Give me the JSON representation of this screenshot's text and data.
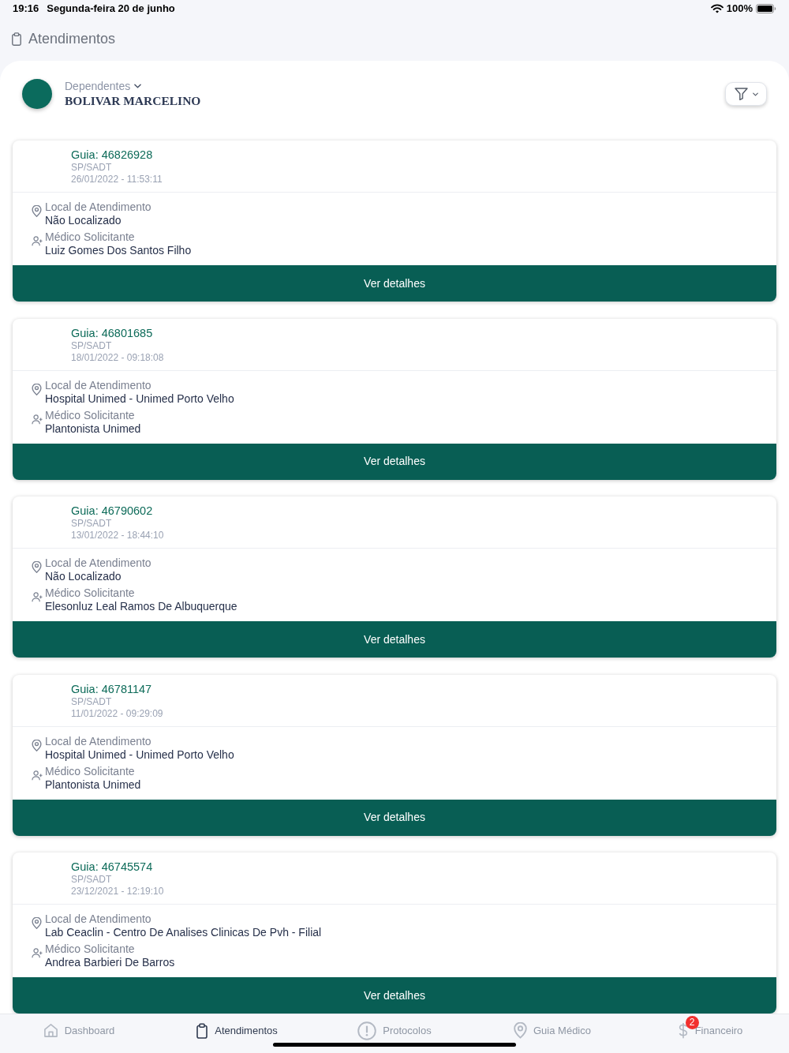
{
  "status_bar": {
    "time": "19:16",
    "date": "Segunda-feira 20 de junho",
    "battery": "100%"
  },
  "header": {
    "title": "Atendimentos"
  },
  "profile": {
    "dropdown_label": "Dependentes",
    "name": "BOLIVAR MARCELINO"
  },
  "guides": [
    {
      "title": "Guia: 46826928",
      "type": "SP/SADT",
      "datetime": "26/01/2022 - 11:53:11",
      "fields": [
        {
          "kind": "location",
          "label": "Local de Atendimento",
          "value": "Não Localizado"
        },
        {
          "kind": "doctor",
          "label": "Médico Solicitante",
          "value": "Luiz Gomes Dos Santos Filho"
        }
      ],
      "button": "Ver detalhes"
    },
    {
      "title": "Guia: 46801685",
      "type": "SP/SADT",
      "datetime": "18/01/2022 - 09:18:08",
      "fields": [
        {
          "kind": "location",
          "label": "Local de Atendimento",
          "value": "Hospital Unimed - Unimed Porto Velho"
        },
        {
          "kind": "doctor",
          "label": "Médico Solicitante",
          "value": "Plantonista Unimed"
        }
      ],
      "button": "Ver detalhes"
    },
    {
      "title": "Guia: 46790602",
      "type": "SP/SADT",
      "datetime": "13/01/2022 - 18:44:10",
      "fields": [
        {
          "kind": "location",
          "label": "Local de Atendimento",
          "value": "Não Localizado"
        },
        {
          "kind": "doctor",
          "label": "Médico Solicitante",
          "value": "Elesonluz Leal Ramos De Albuquerque"
        }
      ],
      "button": "Ver detalhes"
    },
    {
      "title": "Guia: 46781147",
      "type": "SP/SADT",
      "datetime": "11/01/2022 - 09:29:09",
      "fields": [
        {
          "kind": "location",
          "label": "Local de Atendimento",
          "value": "Hospital Unimed - Unimed Porto Velho"
        },
        {
          "kind": "doctor",
          "label": "Médico Solicitante",
          "value": "Plantonista Unimed"
        }
      ],
      "button": "Ver detalhes"
    },
    {
      "title": "Guia: 46745574",
      "type": "SP/SADT",
      "datetime": "23/12/2021 - 12:19:10",
      "fields": [
        {
          "kind": "location",
          "label": "Local de Atendimento",
          "value": "Lab Ceaclin - Centro De Analises Clinicas De Pvh - Filial"
        },
        {
          "kind": "doctor",
          "label": "Médico Solicitante",
          "value": "Andrea Barbieri De Barros"
        }
      ],
      "button": "Ver detalhes"
    }
  ],
  "tab_bar": [
    {
      "kind": "home",
      "label": "Dashboard",
      "selected": false
    },
    {
      "kind": "clipboard",
      "label": "Atendimentos",
      "selected": true
    },
    {
      "kind": "alert",
      "label": "Protocolos",
      "selected": false
    },
    {
      "kind": "pin",
      "label": "Guia Médico",
      "selected": false
    },
    {
      "kind": "money",
      "label": "Financeiro",
      "selected": false,
      "badge": "2"
    }
  ]
}
